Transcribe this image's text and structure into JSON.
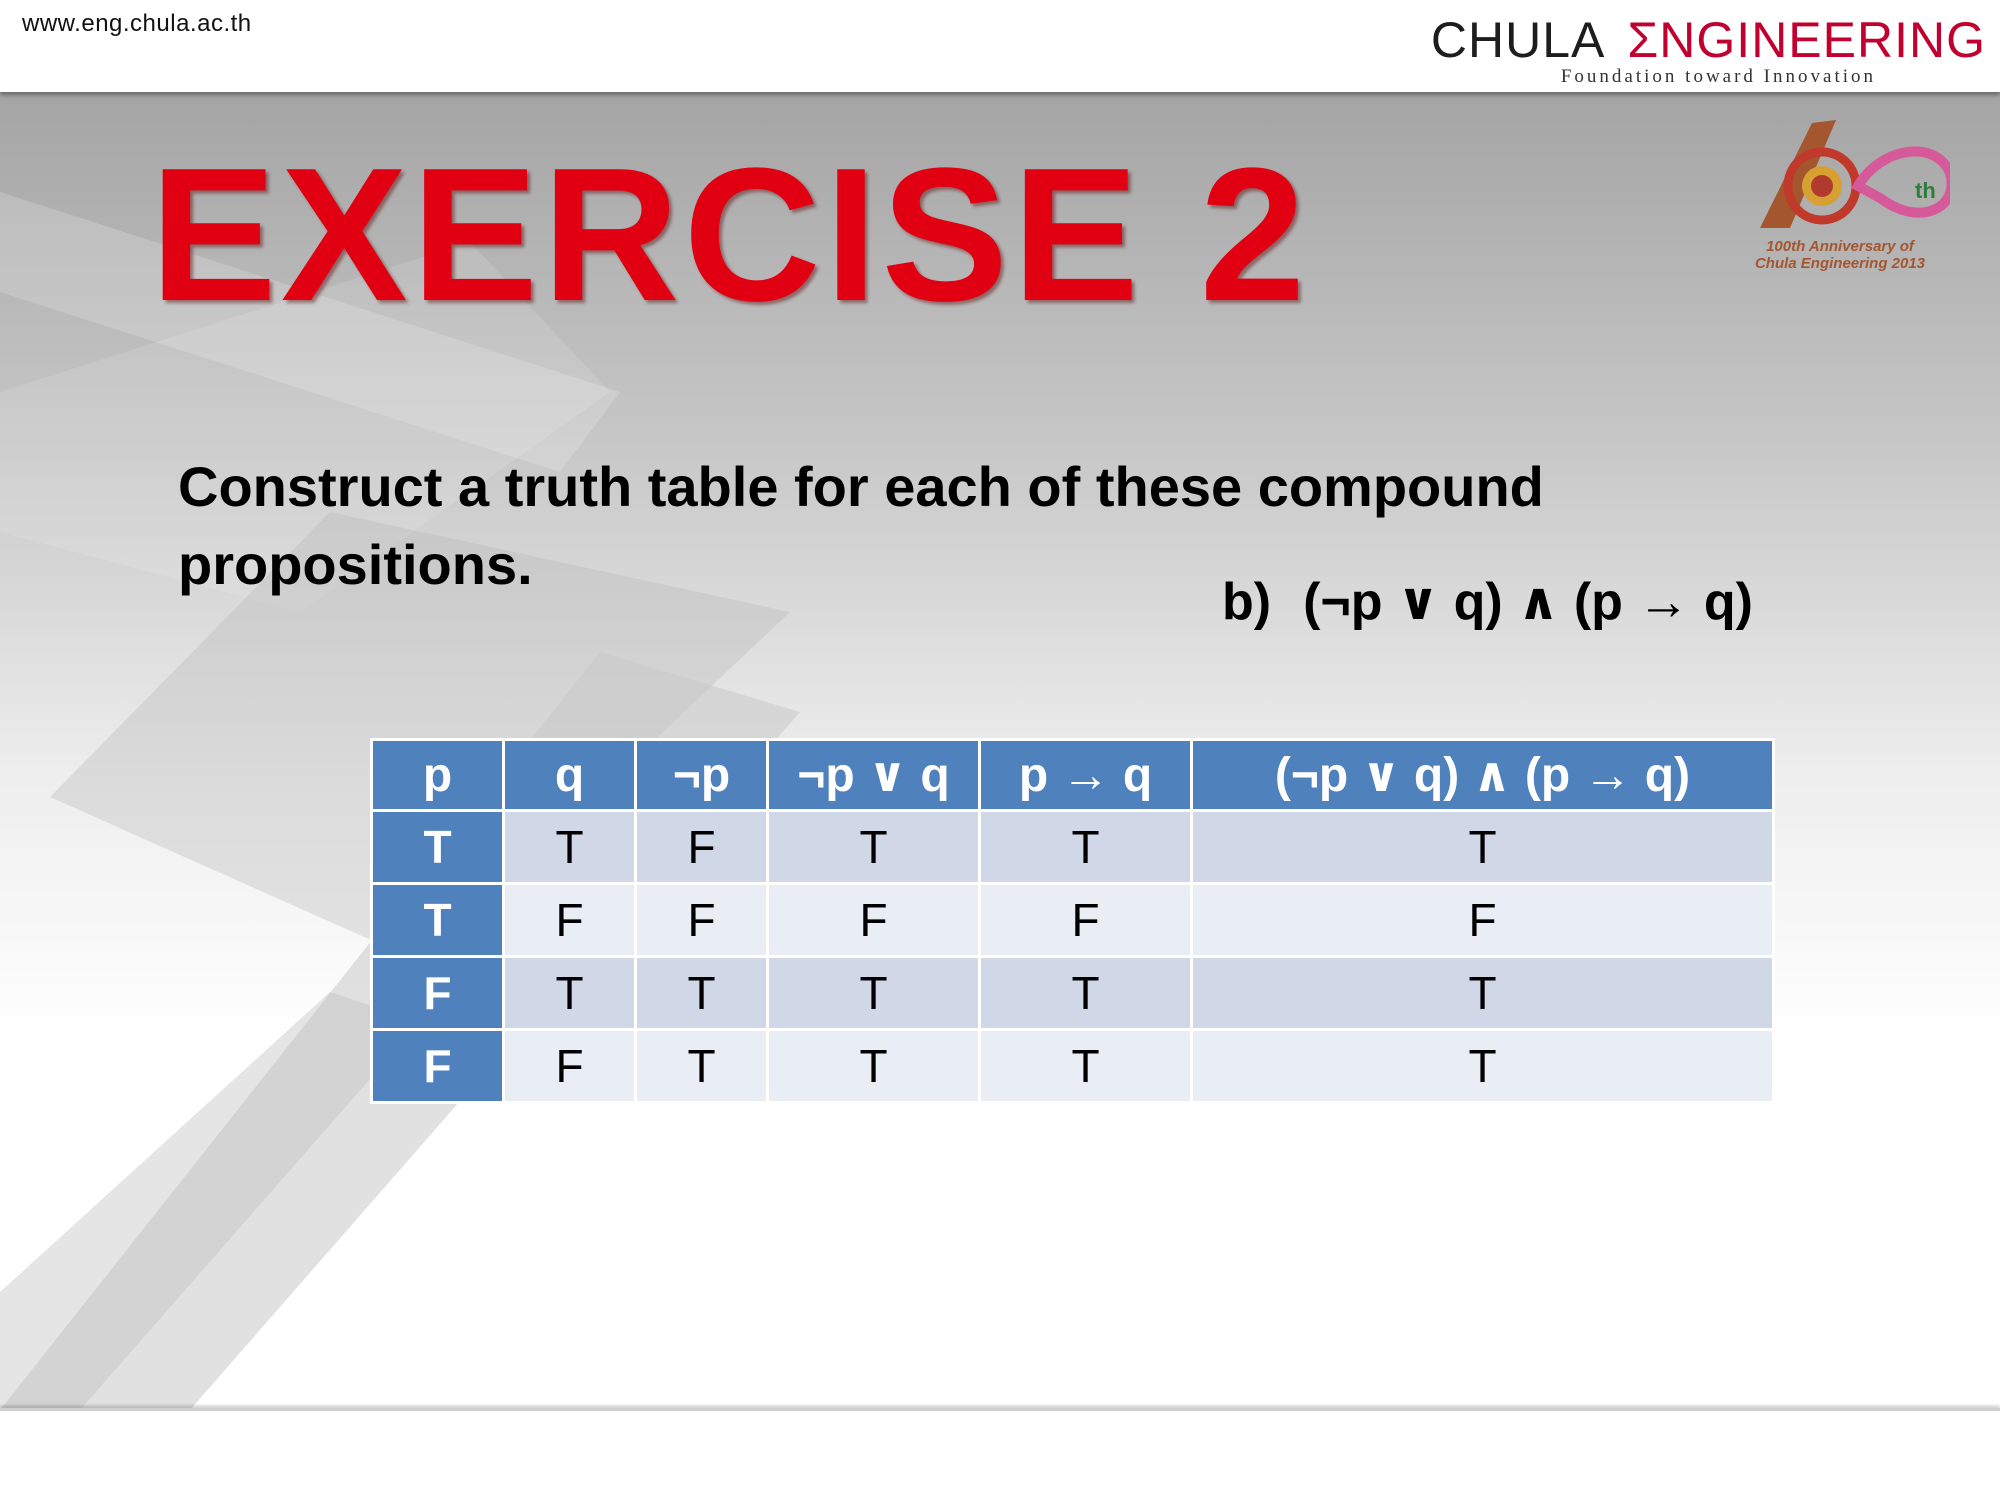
{
  "header": {
    "url": "www.eng.chula.ac.th",
    "brand_left": "CHULA",
    "brand_right": "ΣNGINEERING",
    "tagline": "Foundation toward Innovation"
  },
  "anniversary": {
    "caption_line1": "100th Anniversary of",
    "caption_line2": "Chula Engineering 2013"
  },
  "slide": {
    "title": "EXERCISE 2",
    "instruction": "Construct a truth table for each of these compound propositions.",
    "part_label": "b)",
    "expression": "(¬p ∨ q) ∧ (p → q)"
  },
  "table": {
    "headers": [
      "p",
      "q",
      "¬p",
      "¬p ∨ q",
      "p → q",
      "(¬p ∨ q) ∧ (p → q)"
    ],
    "rows": [
      [
        "T",
        "T",
        "F",
        "T",
        "T",
        "T"
      ],
      [
        "T",
        "F",
        "F",
        "F",
        "F",
        "F"
      ],
      [
        "F",
        "T",
        "T",
        "T",
        "T",
        "T"
      ],
      [
        "F",
        "F",
        "T",
        "T",
        "T",
        "T"
      ]
    ]
  },
  "colors": {
    "title": "#e00012",
    "header_fill": "#4f81bd",
    "row_odd": "#d0d8e8",
    "row_even": "#e9edf4",
    "brand_accent": "#c2002f"
  }
}
